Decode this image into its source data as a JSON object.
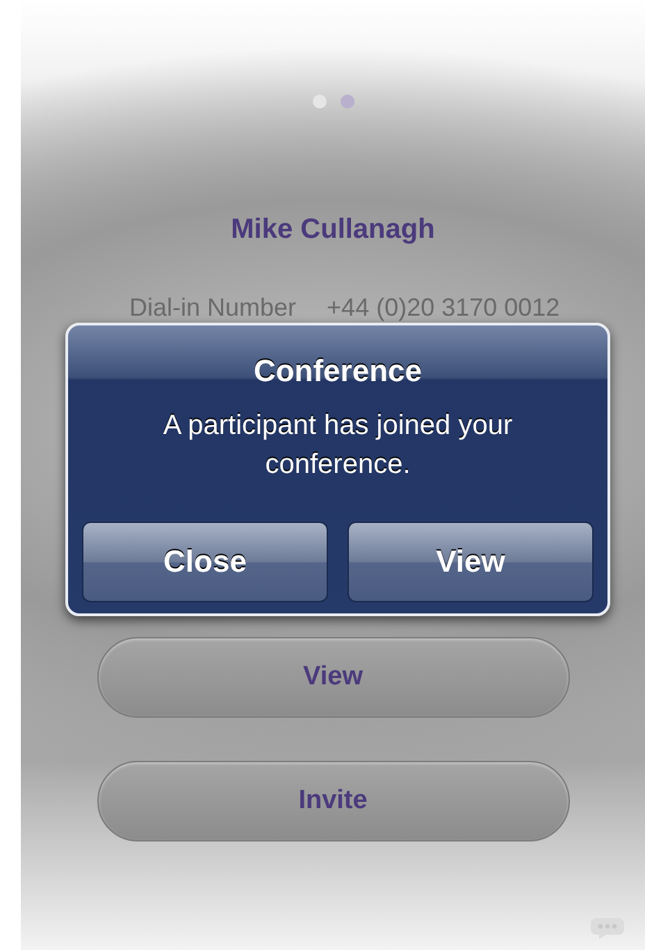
{
  "page_dots": [
    {
      "selected": false
    },
    {
      "selected": true
    }
  ],
  "contact": {
    "name": "Mike Cullanagh"
  },
  "details": [
    {
      "label": "Dial-in Number",
      "value": "+44 (0)20 3170 0012"
    }
  ],
  "actions": [
    {
      "label": "View"
    },
    {
      "label": "Invite"
    }
  ],
  "alert": {
    "title": "Conference",
    "message": "A participant has joined your conference.",
    "buttons": [
      "Close",
      "View"
    ]
  }
}
